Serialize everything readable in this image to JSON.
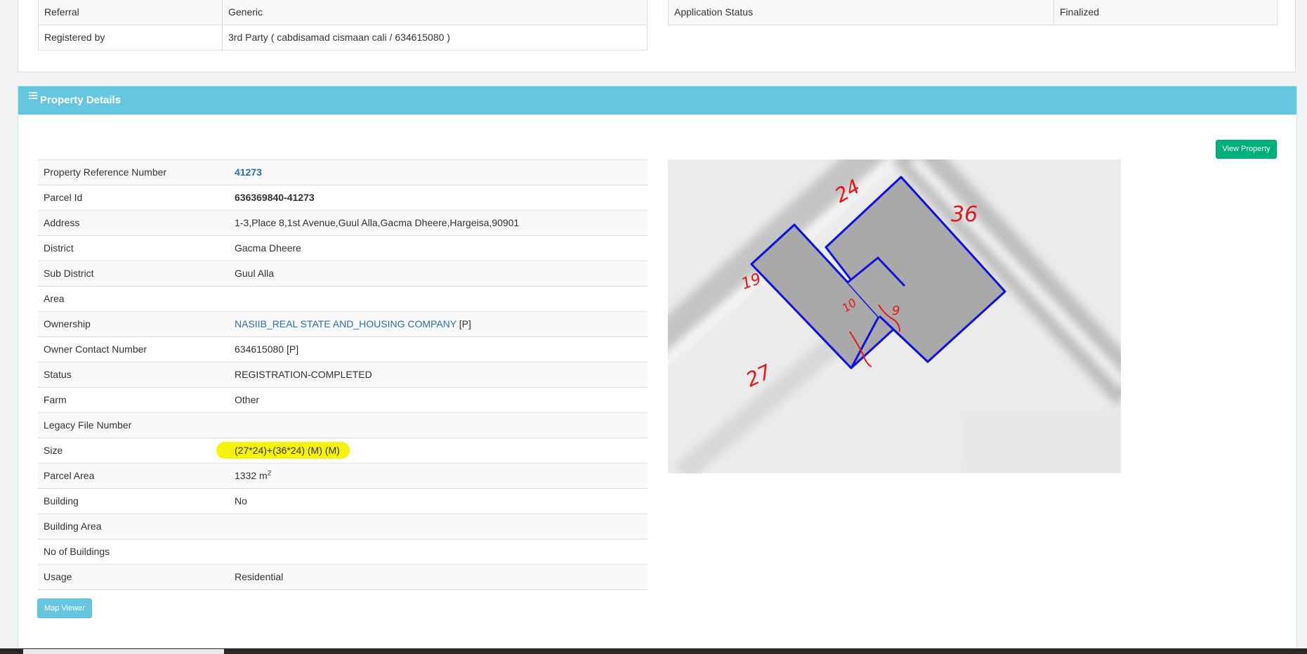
{
  "top_panel": {
    "left_rows": [
      {
        "label": "Referral",
        "value": "Generic"
      },
      {
        "label": "Registered by",
        "value": "3rd Party ( cabdisamad cismaan cali / 634615080 )"
      }
    ],
    "right_rows": [
      {
        "label": "Application Status",
        "value": "Finalized"
      }
    ]
  },
  "property_details": {
    "heading": "Property Details",
    "view_property_button": "View Property",
    "map_viewer_button": "Map Viewer",
    "rows": [
      {
        "label": "Property Reference Number",
        "value": "41273"
      },
      {
        "label": "Parcel Id",
        "value": "636369840-41273"
      },
      {
        "label": "Address",
        "value": "1-3,Place 8,1st Avenue,Guul Alla,Gacma Dheere,Hargeisa,90901"
      },
      {
        "label": "District",
        "value": "Gacma Dheere"
      },
      {
        "label": "Sub District",
        "value": "Guul Alla"
      },
      {
        "label": "Area",
        "value": ""
      },
      {
        "label": "Ownership",
        "value": "NASIIB_REAL STATE AND_HOUSING COMPANY",
        "suffix": "[P]"
      },
      {
        "label": "Owner Contact Number",
        "value": "634615080 [P]"
      },
      {
        "label": "Status",
        "value": "REGISTRATION-COMPLETED"
      },
      {
        "label": "Farm",
        "value": "Other"
      },
      {
        "label": "Legacy File Number",
        "value": ""
      },
      {
        "label": "Size",
        "value": "(27*24)+(36*24) (M) (M)"
      },
      {
        "label": "Parcel Area",
        "value": "1332 m",
        "unit_sup": "2"
      },
      {
        "label": "Building",
        "value": "No"
      },
      {
        "label": "Building Area",
        "value": ""
      },
      {
        "label": "No of Buildings",
        "value": ""
      },
      {
        "label": "Usage",
        "value": "Residential"
      }
    ],
    "map_annotations": [
      "24",
      "36",
      "19",
      "10",
      "9",
      "27"
    ]
  },
  "colors": {
    "panel_heading": "#67c6df",
    "view_button": "#00b07a",
    "link": "#2a6fa8",
    "highlight": "#f7f20a",
    "parcel_outline": "#1010e0",
    "annotation_ink": "#e8141a"
  }
}
